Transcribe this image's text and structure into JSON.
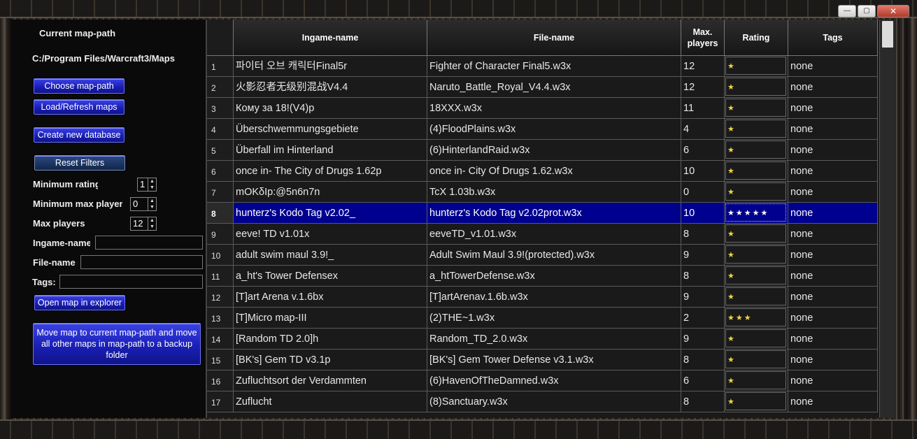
{
  "window": {
    "minimize_icon": "minimize-icon",
    "maximize_icon": "maximize-icon",
    "close_icon": "close-icon",
    "minimize_glyph": "—",
    "maximize_glyph": "▢",
    "close_glyph": "✕"
  },
  "left_panel": {
    "map_path_label": "Current map-path",
    "map_path_value": "C:/Program Files/Warcraft3/Maps",
    "choose_button": "Choose map-path",
    "load_button": "Load/Refresh maps",
    "create_db_button": "Create new database",
    "reset_filters_button": "Reset Filters",
    "min_rating_label": "Minimum rating",
    "min_rating_value": "1",
    "min_max_players_label": "Minimum max players",
    "min_max_players_value": "0",
    "max_players_label": "Max players",
    "max_players_value": "12",
    "ingame_name_label": "Ingame-name",
    "file_name_label": "File-name",
    "tags_label": "Tags:",
    "open_explorer_button": "Open map in explorer",
    "move_map_button": "Move map to current map-path and move all other maps in map-path to a backup folder"
  },
  "table": {
    "columns": {
      "ingame": "Ingame-name",
      "file": "File-name",
      "max": "Max. players",
      "rating": "Rating",
      "tags": "Tags"
    },
    "selected_row": 8,
    "rows": [
      {
        "n": "1",
        "ingame": "파이터 오브 캐릭터Final5r",
        "file": "Fighter of Character Final5.w3x",
        "max": "12",
        "rating": "★",
        "tags": "none"
      },
      {
        "n": "2",
        "ingame": "火影忍者无级别混战V4.4",
        "file": "Naruto_Battle_Royal_V4.4.w3x",
        "max": "12",
        "rating": "★",
        "tags": "none"
      },
      {
        "n": "3",
        "ingame": "Кому за 18!(V4)p",
        "file": "18XXX.w3x",
        "max": "11",
        "rating": "★",
        "tags": "none"
      },
      {
        "n": "4",
        "ingame": "Überschwemmungsgebiete",
        "file": "(4)FloodPlains.w3x",
        "max": "4",
        "rating": "★",
        "tags": "none"
      },
      {
        "n": "5",
        "ingame": "Überfall im Hinterland",
        "file": "(6)HinterlandRaid.w3x",
        "max": "6",
        "rating": "★",
        "tags": "none"
      },
      {
        "n": "6",
        "ingame": "once in- The City of Drugs 1.62p",
        "file": "once in- City Of Drugs 1.62.w3x",
        "max": "10",
        "rating": "★",
        "tags": "none"
      },
      {
        "n": "7",
        "ingame": "mOKδIp:@5n6n7n",
        "file": "TcX 1.03b.w3x",
        "max": "0",
        "rating": "★",
        "tags": "none"
      },
      {
        "n": "8",
        "ingame": "hunterz's Kodo Tag v2.02_",
        "file": "hunterz's Kodo Tag v2.02prot.w3x",
        "max": "10",
        "rating": "★★★★★",
        "tags": "none"
      },
      {
        "n": "9",
        "ingame": "eeve! TD v1.01x",
        "file": "eeveTD_v1.01.w3x",
        "max": "8",
        "rating": "★",
        "tags": "none"
      },
      {
        "n": "10",
        "ingame": "adult swim maul 3.9!_",
        "file": "Adult Swim Maul 3.9!(protected).w3x",
        "max": "9",
        "rating": "★",
        "tags": "none"
      },
      {
        "n": "11",
        "ingame": "a_ht's Tower Defensex",
        "file": "a_htTowerDefense.w3x",
        "max": "8",
        "rating": "★",
        "tags": "none"
      },
      {
        "n": "12",
        "ingame": "[T]art Arena v.1.6bx",
        "file": "[T]artArenav.1.6b.w3x",
        "max": "9",
        "rating": "★",
        "tags": "none"
      },
      {
        "n": "13",
        "ingame": "[T]Micro map-III",
        "file": "(2)THE~1.w3x",
        "max": "2",
        "rating": "★★★",
        "tags": "none"
      },
      {
        "n": "14",
        "ingame": "[Random TD 2.0]h",
        "file": "Random_TD_2.0.w3x",
        "max": "9",
        "rating": "★",
        "tags": "none"
      },
      {
        "n": "15",
        "ingame": "[BK's] Gem TD v3.1p",
        "file": "[BK's] Gem Tower Defense v3.1.w3x",
        "max": "8",
        "rating": "★",
        "tags": "none"
      },
      {
        "n": "16",
        "ingame": "Zufluchtsort der Verdammten",
        "file": "(6)HavenOfTheDamned.w3x",
        "max": "6",
        "rating": "★",
        "tags": "none"
      },
      {
        "n": "17",
        "ingame": "Zuflucht",
        "file": "(8)Sanctuary.w3x",
        "max": "8",
        "rating": "★",
        "tags": "none"
      }
    ]
  }
}
